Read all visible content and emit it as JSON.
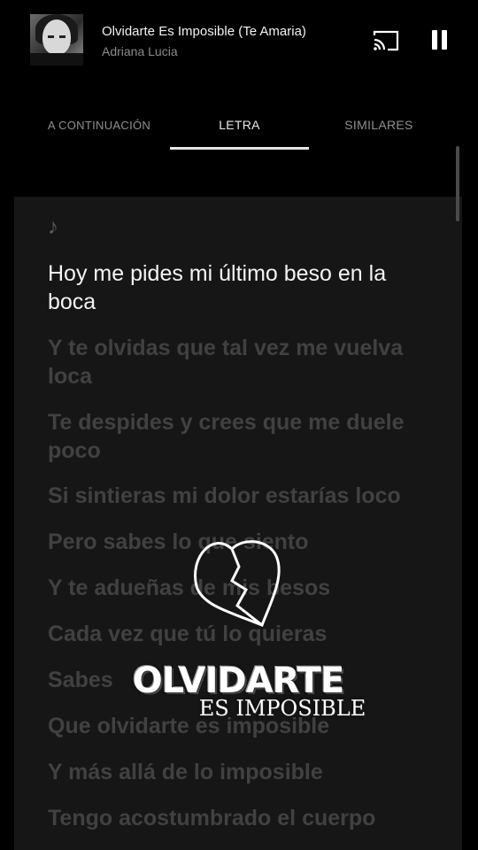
{
  "now_playing": {
    "title": "Olvidarte Es Imposible (Te Amaria)",
    "artist": "Adriana Lucia",
    "cover_icon": "album-cover",
    "cast_icon": "cast-icon",
    "pause_icon": "pause-icon"
  },
  "tabs": [
    {
      "label": "A CONTINUACIÓN"
    },
    {
      "label": "LETRA"
    },
    {
      "label": "SIMILARES"
    }
  ],
  "lyrics": {
    "note": "♪",
    "lines": [
      "Hoy me pides mi último beso en la boca",
      "Y te olvidas que tal vez me vuelva loca",
      "Te despides y crees que me duele poco",
      "Si sintieras mi dolor estarías loco",
      "Pero sabes lo que siento",
      "Y te adueñas de mis besos",
      "Cada vez que tú lo quieras",
      "Sabes",
      "Que olvidarte es imposible",
      "Y más allá de lo imposible",
      "Tengo acostumbrado el cuerpo"
    ]
  },
  "overlay": {
    "title": "OLVIDARTE",
    "subtitle": "ES IMPOSIBLE",
    "heart_icon": "broken-heart-icon"
  },
  "colors": {
    "background": "#000000",
    "panel": "#161616",
    "active_lyric": "#f4f4f4",
    "inactive_lyric": "#414141",
    "tab_active": "#e8e8e8",
    "tab_inactive": "#8f8f8f"
  }
}
